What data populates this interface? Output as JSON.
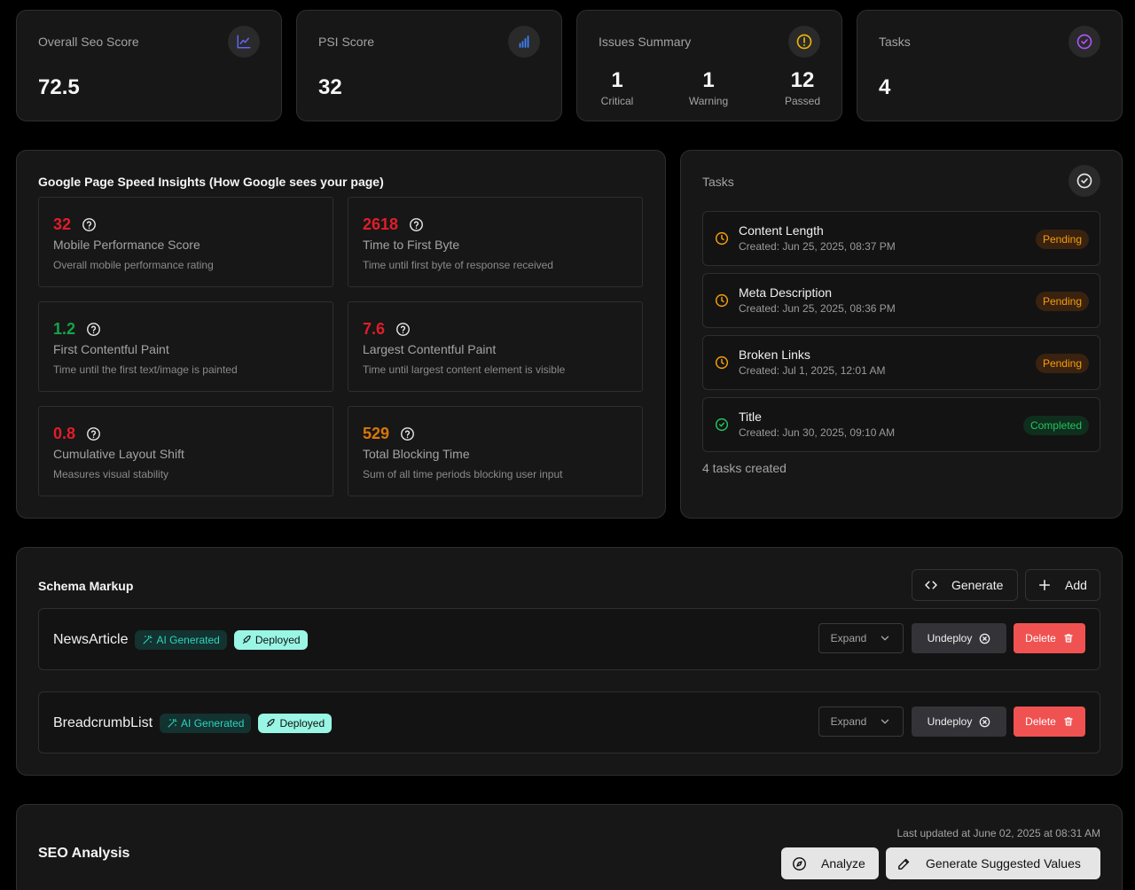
{
  "stats": {
    "seo": {
      "title": "Overall Seo Score",
      "value": "72.5",
      "icon": "line-chart-icon",
      "icon_color": "#6366f1"
    },
    "psi": {
      "title": "PSI Score",
      "value": "32",
      "icon": "bar-chart-icon",
      "icon_color": "#3b82f6"
    },
    "issues": {
      "title": "Issues Summary",
      "icon": "alert-circle-icon",
      "icon_color": "#eab308",
      "critical": {
        "value": "1",
        "label": "Critical"
      },
      "warning": {
        "value": "1",
        "label": "Warning"
      },
      "passed": {
        "value": "12",
        "label": "Passed"
      }
    },
    "tasks": {
      "title": "Tasks",
      "value": "4",
      "icon": "check-circle-icon",
      "icon_color": "#a855f7"
    }
  },
  "psi_panel": {
    "title": "Google Page Speed Insights (How Google sees your page)",
    "metrics": [
      {
        "value": "32",
        "name": "Mobile Performance Score",
        "desc": "Overall mobile performance rating",
        "status": "red"
      },
      {
        "value": "2618",
        "name": "Time to First Byte",
        "desc": "Time until first byte of response received",
        "status": "red"
      },
      {
        "value": "1.2",
        "name": "First Contentful Paint",
        "desc": "Time until the first text/image is painted",
        "status": "green"
      },
      {
        "value": "7.6",
        "name": "Largest Contentful Paint",
        "desc": "Time until largest content element is visible",
        "status": "red"
      },
      {
        "value": "0.8",
        "name": "Cumulative Layout Shift",
        "desc": "Measures visual stability",
        "status": "red"
      },
      {
        "value": "529",
        "name": "Total Blocking Time",
        "desc": "Sum of all time periods blocking user input",
        "status": "orange"
      }
    ]
  },
  "tasks_panel": {
    "title": "Tasks",
    "items": [
      {
        "name": "Content Length",
        "created": "Created: Jun 25, 2025, 08:37 PM",
        "status": "Pending"
      },
      {
        "name": "Meta Description",
        "created": "Created: Jun 25, 2025, 08:36 PM",
        "status": "Pending"
      },
      {
        "name": "Broken Links",
        "created": "Created: Jul 1, 2025, 12:01 AM",
        "status": "Pending"
      },
      {
        "name": "Title",
        "created": "Created: Jun 30, 2025, 09:10 AM",
        "status": "Completed"
      }
    ],
    "footer": "4 tasks created"
  },
  "schema": {
    "title": "Schema Markup",
    "generate_label": "Generate",
    "add_label": "Add",
    "ai_tag": "AI Generated",
    "deployed_tag": "Deployed",
    "expand_label": "Expand",
    "undeploy_label": "Undeploy",
    "delete_label": "Delete",
    "items": [
      {
        "name": "NewsArticle"
      },
      {
        "name": "BreadcrumbList"
      }
    ]
  },
  "seo_analysis": {
    "title": "SEO Analysis",
    "last_updated": "Last updated at June 02, 2025 at 08:31 AM",
    "analyze_label": "Analyze",
    "generate_label": "Generate Suggested Values"
  }
}
